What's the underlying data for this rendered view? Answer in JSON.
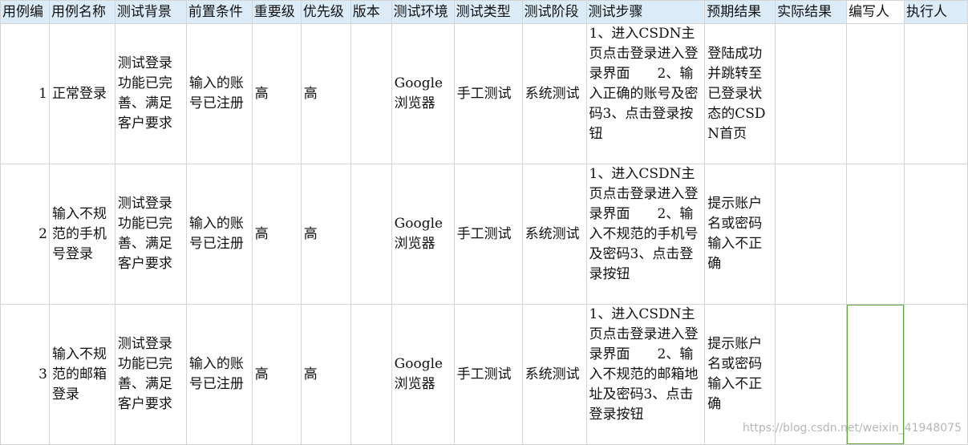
{
  "headers": [
    "用例编",
    "用例名称",
    "测试背景",
    "前置条件",
    "重要级",
    "优先级",
    "版本",
    "测试环境",
    "测试类型",
    "测试阶段",
    "测试步骤",
    "预期结果",
    "实际结果",
    "编写人",
    "执行人"
  ],
  "rows": [
    {
      "id": "1",
      "name": "正常登录",
      "background": "测试登录功能已完善、满足客户要求",
      "precondition": "输入的账号已注册",
      "importance": "高",
      "priority": "高",
      "version": "",
      "environment": "Google浏览器",
      "test_type": "手工测试",
      "stage": "系统测试",
      "steps": "1、进入CSDN主页点击登录进入登录界面　　2、输入正确的账号及密码3、点击登录按钮",
      "expected": "登陆成功并跳转至已登录状态的CSDN首页",
      "actual": "",
      "author": "",
      "executor": ""
    },
    {
      "id": "2",
      "name": "输入不规范的手机号登录",
      "background": "测试登录功能已完善、满足客户要求",
      "precondition": "输入的账号已注册",
      "importance": "高",
      "priority": "高",
      "version": "",
      "environment": "Google浏览器",
      "test_type": "手工测试",
      "stage": "系统测试",
      "steps": "1、进入CSDN主页点击登录进入登录界面　　2、输入不规范的手机号及密码3、点击登录按钮",
      "expected": "提示账户名或密码输入不正确",
      "actual": "",
      "author": "",
      "executor": ""
    },
    {
      "id": "3",
      "name": "输入不规范的邮箱登录",
      "background": "测试登录功能已完善、满足客户要求",
      "precondition": "输入的账号已注册",
      "importance": "高",
      "priority": "高",
      "version": "",
      "environment": "Google浏览器",
      "test_type": "手工测试",
      "stage": "系统测试",
      "steps": "1、进入CSDN主页点击登录进入登录界面　　2、输入不规范的邮箱地址及密码3、点击登录按钮",
      "expected": "提示账户名或密码输入不正确",
      "actual": "",
      "author": "",
      "executor": ""
    }
  ],
  "watermark": "https://blog.csdn.net/weixin_41948075",
  "colors": {
    "header_highlight": "#dcebf8",
    "selection_border": "#5ea63a",
    "grid_line": "#d4d4d4"
  }
}
